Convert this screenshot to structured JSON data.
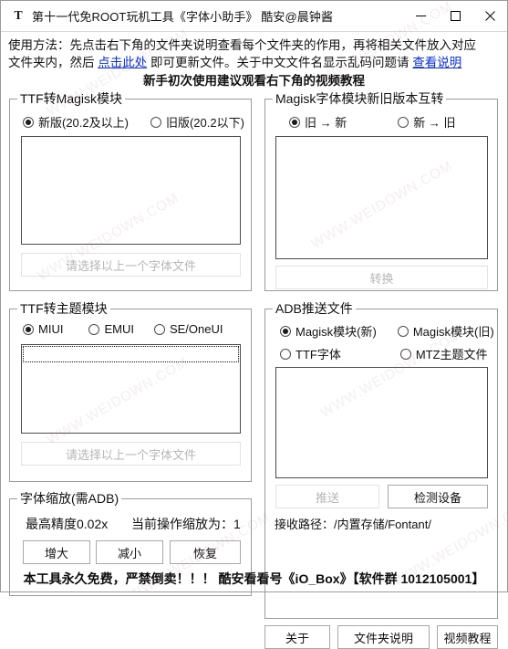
{
  "window": {
    "icon": "letter-t-icon",
    "title": "第十一代免ROOT玩机工具《字体小助手》 酷安@晨钟酱",
    "controls": {
      "minimize": "minimize-icon",
      "maximize": "maximize-icon",
      "close": "close-icon"
    }
  },
  "instructions": {
    "line1": "使用方法：先点击右下角的文件夹说明查看每个文件夹的作用，再将相关文件放入对应",
    "line2_a": "文件夹内，然后",
    "line2_link1": "点击此处",
    "line2_b": "即可更新文件。关于中文文件名显示乱码问题请",
    "line2_link2": "查看说明",
    "line3": "新手初次使用建议观看右下角的视频教程"
  },
  "ttf_to_magisk": {
    "title": "TTF转Magisk模块",
    "options": [
      {
        "label": "新版(20.2及以上)",
        "checked": true
      },
      {
        "label": "旧版(20.2以下)",
        "checked": false
      }
    ],
    "list_items": [],
    "action_button": {
      "label": "请选择以上一个字体文件",
      "disabled": true
    }
  },
  "magisk_convert": {
    "title": "Magisk字体模块新旧版本互转",
    "options": [
      {
        "label": "旧 → 新",
        "checked": true
      },
      {
        "label": "新 → 旧",
        "checked": false
      }
    ],
    "list_items": [],
    "action_button": {
      "label": "转换",
      "disabled": true
    }
  },
  "ttf_to_theme": {
    "title": "TTF转主题模块",
    "options": [
      {
        "label": "MIUI",
        "checked": true
      },
      {
        "label": "EMUI",
        "checked": false
      },
      {
        "label": "SE/OneUI",
        "checked": false
      }
    ],
    "list_items": [],
    "focused_row": true,
    "action_button": {
      "label": "请选择以上一个字体文件",
      "disabled": true
    }
  },
  "adb_push": {
    "title": "ADB推送文件",
    "options": [
      {
        "label": "Magisk模块(新)",
        "checked": true
      },
      {
        "label": "Magisk模块(旧)",
        "checked": false
      },
      {
        "label": "TTF字体",
        "checked": false
      },
      {
        "label": "MTZ主题文件",
        "checked": false
      }
    ],
    "list_items": [],
    "push_button": {
      "label": "推送",
      "disabled": true
    },
    "detect_button": {
      "label": "检测设备",
      "disabled": false
    },
    "receive_path_label": "接收路径：/内置存储/Fontant/"
  },
  "font_scale": {
    "title": "字体缩放(需ADB)",
    "precision_label": "最高精度0.02x",
    "current_label": "当前操作缩放为：1",
    "buttons": [
      {
        "label": "增大"
      },
      {
        "label": "减小"
      },
      {
        "label": "恢复"
      }
    ]
  },
  "bottom_buttons": [
    {
      "label": "关于"
    },
    {
      "label": "文件夹说明"
    },
    {
      "label": "视频教程"
    }
  ],
  "footer": {
    "text": "本工具永久免费，严禁倒卖！！！ 酷安看看号《iO_Box》【软件群 1012105001】"
  },
  "watermark": {
    "text": "WWW.WEIDOWN.COM"
  },
  "colors": {
    "link": "#0b2fd6",
    "border": "#9b9b9b",
    "disabled_text": "#b6b6b6",
    "text": "#101010"
  }
}
